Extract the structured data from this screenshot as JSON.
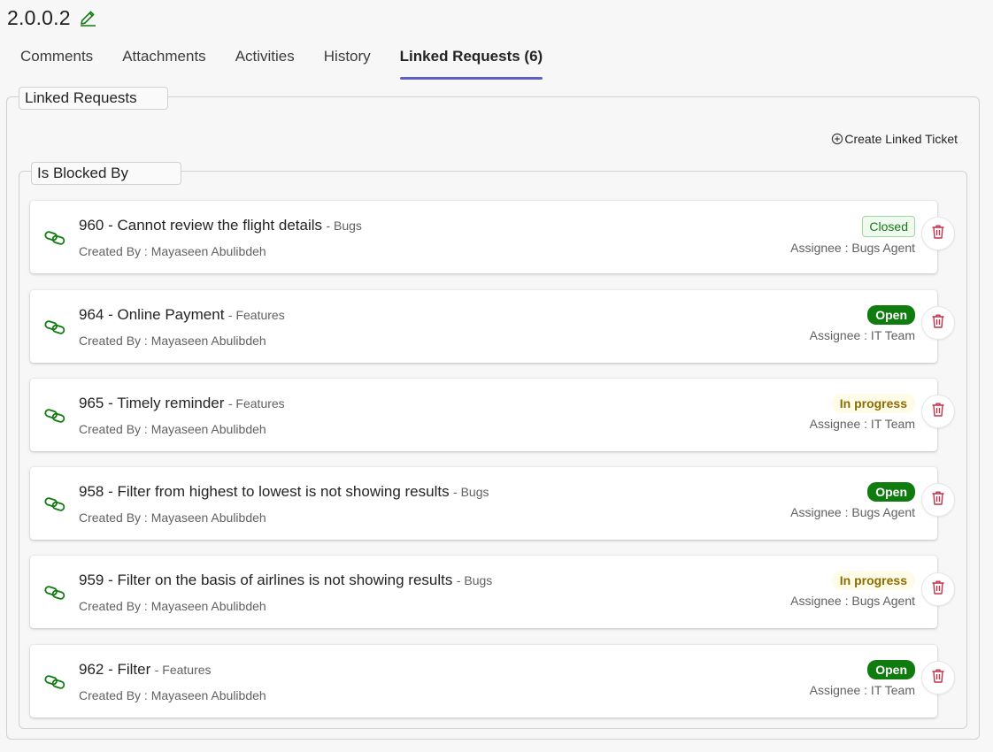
{
  "header": {
    "title": "2.0.0.2"
  },
  "tabs": [
    {
      "label": "Comments"
    },
    {
      "label": "Attachments"
    },
    {
      "label": "Activities"
    },
    {
      "label": "History"
    },
    {
      "label": "Linked Requests (6)"
    }
  ],
  "section": {
    "title": "Linked Requests",
    "create_label": "Create Linked Ticket",
    "group_title": "Is Blocked By"
  },
  "colors": {
    "accent": "#5b5fc7",
    "link_icon": "#107c10",
    "delete_icon": "#c4314b"
  },
  "requests": [
    {
      "number": "960",
      "separator": " - ",
      "title": "Cannot review the flight details",
      "category": "- Bugs",
      "created_by": "Created By : Mayaseen Abulibdeh",
      "status": "Closed",
      "assignee": "Assignee : Bugs Agent"
    },
    {
      "number": "964",
      "separator": " - ",
      "title": "Online Payment",
      "category": "- Features",
      "created_by": "Created By : Mayaseen Abulibdeh",
      "status": "Open",
      "assignee": "Assignee : IT Team"
    },
    {
      "number": "965",
      "separator": " - ",
      "title": "Timely reminder",
      "category": "- Features",
      "created_by": "Created By : Mayaseen Abulibdeh",
      "status": "In progress",
      "assignee": "Assignee : IT Team"
    },
    {
      "number": "958",
      "separator": " - ",
      "title": "Filter from highest to lowest is not showing results",
      "category": "- Bugs",
      "created_by": "Created By : Mayaseen Abulibdeh",
      "status": "Open",
      "assignee": "Assignee : Bugs Agent"
    },
    {
      "number": "959",
      "separator": " - ",
      "title": "Filter on the basis of airlines is not showing results",
      "category": "- Bugs",
      "created_by": "Created By : Mayaseen Abulibdeh",
      "status": "In progress",
      "assignee": "Assignee : Bugs Agent"
    },
    {
      "number": "962",
      "separator": " - ",
      "title": "Filter",
      "category": "- Features",
      "created_by": "Created By : Mayaseen Abulibdeh",
      "status": "Open",
      "assignee": "Assignee : IT Team"
    }
  ]
}
